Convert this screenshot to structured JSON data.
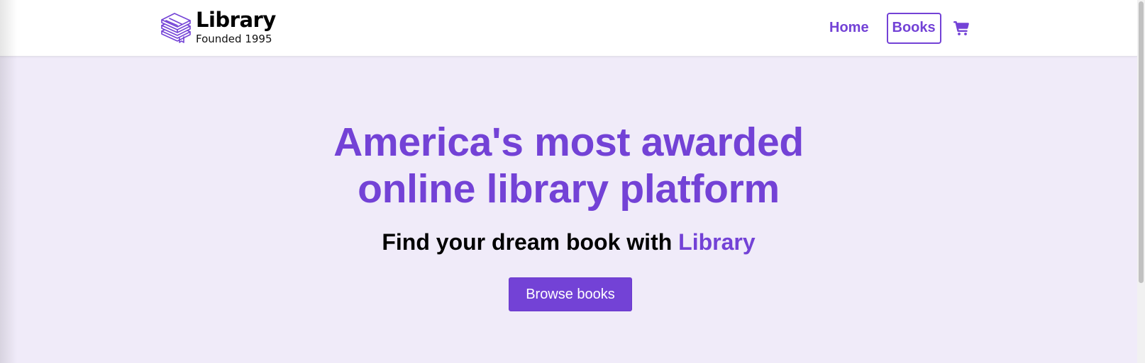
{
  "brand": {
    "name": "Library",
    "tagline": "Founded 1995",
    "icon": "books-stack-icon"
  },
  "nav": {
    "items": [
      {
        "label": "Home",
        "active": false
      },
      {
        "label": "Books",
        "active": true
      }
    ],
    "cart_icon": "cart-icon"
  },
  "hero": {
    "title_line1": "America's most awarded",
    "title_line2": "online library platform",
    "subtitle_prefix": "Find your dream book with ",
    "subtitle_highlight": "Library",
    "cta_label": "Browse books"
  },
  "colors": {
    "accent": "#7342d6",
    "hero_background": "#f0ebf9",
    "navbar_background": "#ffffff",
    "text_dark": "#000000"
  }
}
